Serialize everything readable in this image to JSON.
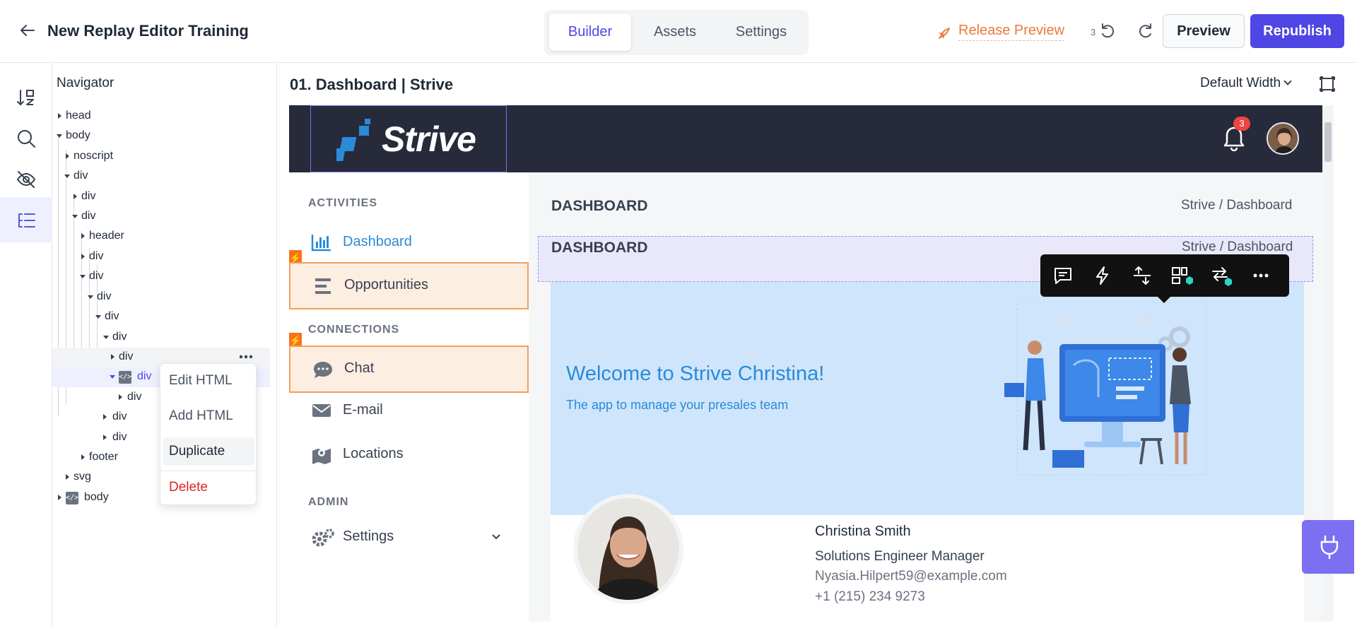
{
  "topbar": {
    "title": "New Replay Editor Training",
    "tabs": [
      {
        "label": "Builder"
      },
      {
        "label": "Assets"
      },
      {
        "label": "Settings"
      }
    ],
    "release_preview": "Release Preview",
    "undo_count": "3",
    "preview_label": "Preview",
    "republish_label": "Republish"
  },
  "rail": {
    "items": [
      "sort-icon",
      "search-icon",
      "eye-slash-icon",
      "tree-list-icon"
    ],
    "active": "tree-list-icon"
  },
  "navigator": {
    "title": "Navigator",
    "nodes": [
      {
        "label": "head"
      },
      {
        "label": "body"
      },
      {
        "label": "noscript"
      },
      {
        "label": "div"
      },
      {
        "label": "div"
      },
      {
        "label": "div"
      },
      {
        "label": "header"
      },
      {
        "label": "div"
      },
      {
        "label": "div"
      },
      {
        "label": "div"
      },
      {
        "label": "div"
      },
      {
        "label": "div"
      },
      {
        "label": "div"
      },
      {
        "label": "div"
      },
      {
        "label": "div"
      },
      {
        "label": "div"
      },
      {
        "label": "div"
      },
      {
        "label": "footer"
      },
      {
        "label": "svg"
      },
      {
        "label": "body"
      }
    ],
    "context_menu": {
      "items": [
        {
          "label": "Edit HTML"
        },
        {
          "label": "Add HTML"
        },
        {
          "label": "Duplicate"
        },
        {
          "label": "Delete"
        }
      ]
    }
  },
  "canvas": {
    "page_title": "01. Dashboard | Strive",
    "width_option": "Default Width"
  },
  "site": {
    "logo": "Strive",
    "notification_count": "3",
    "sidebar": {
      "sections": [
        {
          "title": "ACTIVITIES"
        },
        {
          "title": "CONNECTIONS"
        },
        {
          "title": "ADMIN"
        }
      ],
      "items": [
        {
          "label": "Dashboard",
          "icon": "bar-chart-icon"
        },
        {
          "label": "Opportunities",
          "icon": "bars-icon"
        },
        {
          "label": "Chat",
          "icon": "chat-icon"
        },
        {
          "label": "E-mail",
          "icon": "mail-icon"
        },
        {
          "label": "Locations",
          "icon": "map-icon"
        },
        {
          "label": "Settings",
          "icon": "gear-icon"
        }
      ]
    },
    "main": {
      "title": "DASHBOARD",
      "breadcrumb": "Strive  /  Dashboard",
      "selected_title": "DASHBOARD",
      "selected_breadcrumb": "Strive  /  Dashboard",
      "welcome_title": "Welcome to Strive Christina!",
      "welcome_sub": "The app to manage your presales team",
      "profile": {
        "name": "Christina Smith",
        "role": "Solutions Engineer Manager",
        "email": "Nyasia.Hilpert59@example.com",
        "phone": "+1 (215) 234 9273"
      }
    }
  },
  "colors": {
    "accent": "#4f46e5",
    "release": "#ea7a3c",
    "site_header": "#272a3a",
    "link_blue": "#2a8bd8",
    "flag_orange": "#f97316"
  }
}
